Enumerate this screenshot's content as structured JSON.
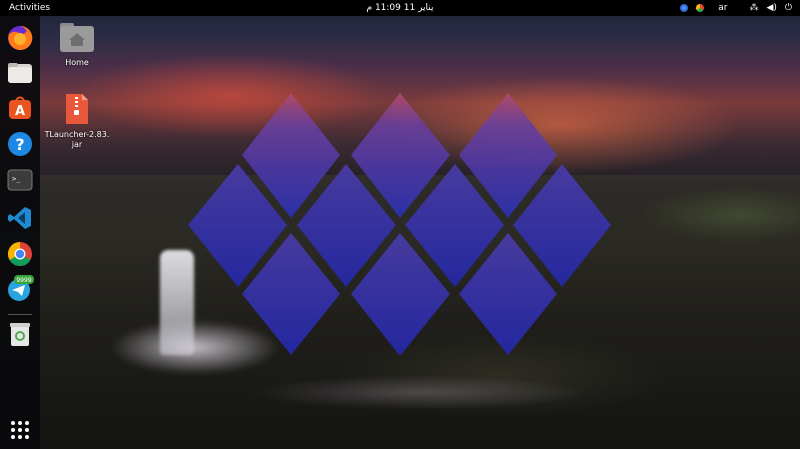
{
  "topbar": {
    "activities": "Activities",
    "clock": "يناير 11 11:09 م",
    "language": "ar"
  },
  "dock": {
    "items": [
      {
        "name": "firefox",
        "icon": "firefox-icon"
      },
      {
        "name": "files",
        "icon": "folder-icon"
      },
      {
        "name": "ubuntu-software",
        "icon": "software-store-icon"
      },
      {
        "name": "help",
        "icon": "help-icon",
        "glyph": "?"
      },
      {
        "name": "terminal",
        "icon": "terminal-icon",
        "glyph": ">_"
      },
      {
        "name": "vscode",
        "icon": "vscode-icon"
      },
      {
        "name": "chrome",
        "icon": "chrome-icon"
      },
      {
        "name": "telegram",
        "icon": "telegram-icon",
        "badge": "9999"
      },
      {
        "name": "trash",
        "icon": "trash-icon"
      },
      {
        "name": "show-applications",
        "icon": "app-grid-icon"
      }
    ]
  },
  "desktop": {
    "home_label": "Home",
    "file_label_line1": "TLauncher-2.83.",
    "file_label_line2": "jar"
  },
  "colors": {
    "accent": "#e95420",
    "diamond_top": "#7a3f8c",
    "diamond_bottom": "#2830a8"
  }
}
